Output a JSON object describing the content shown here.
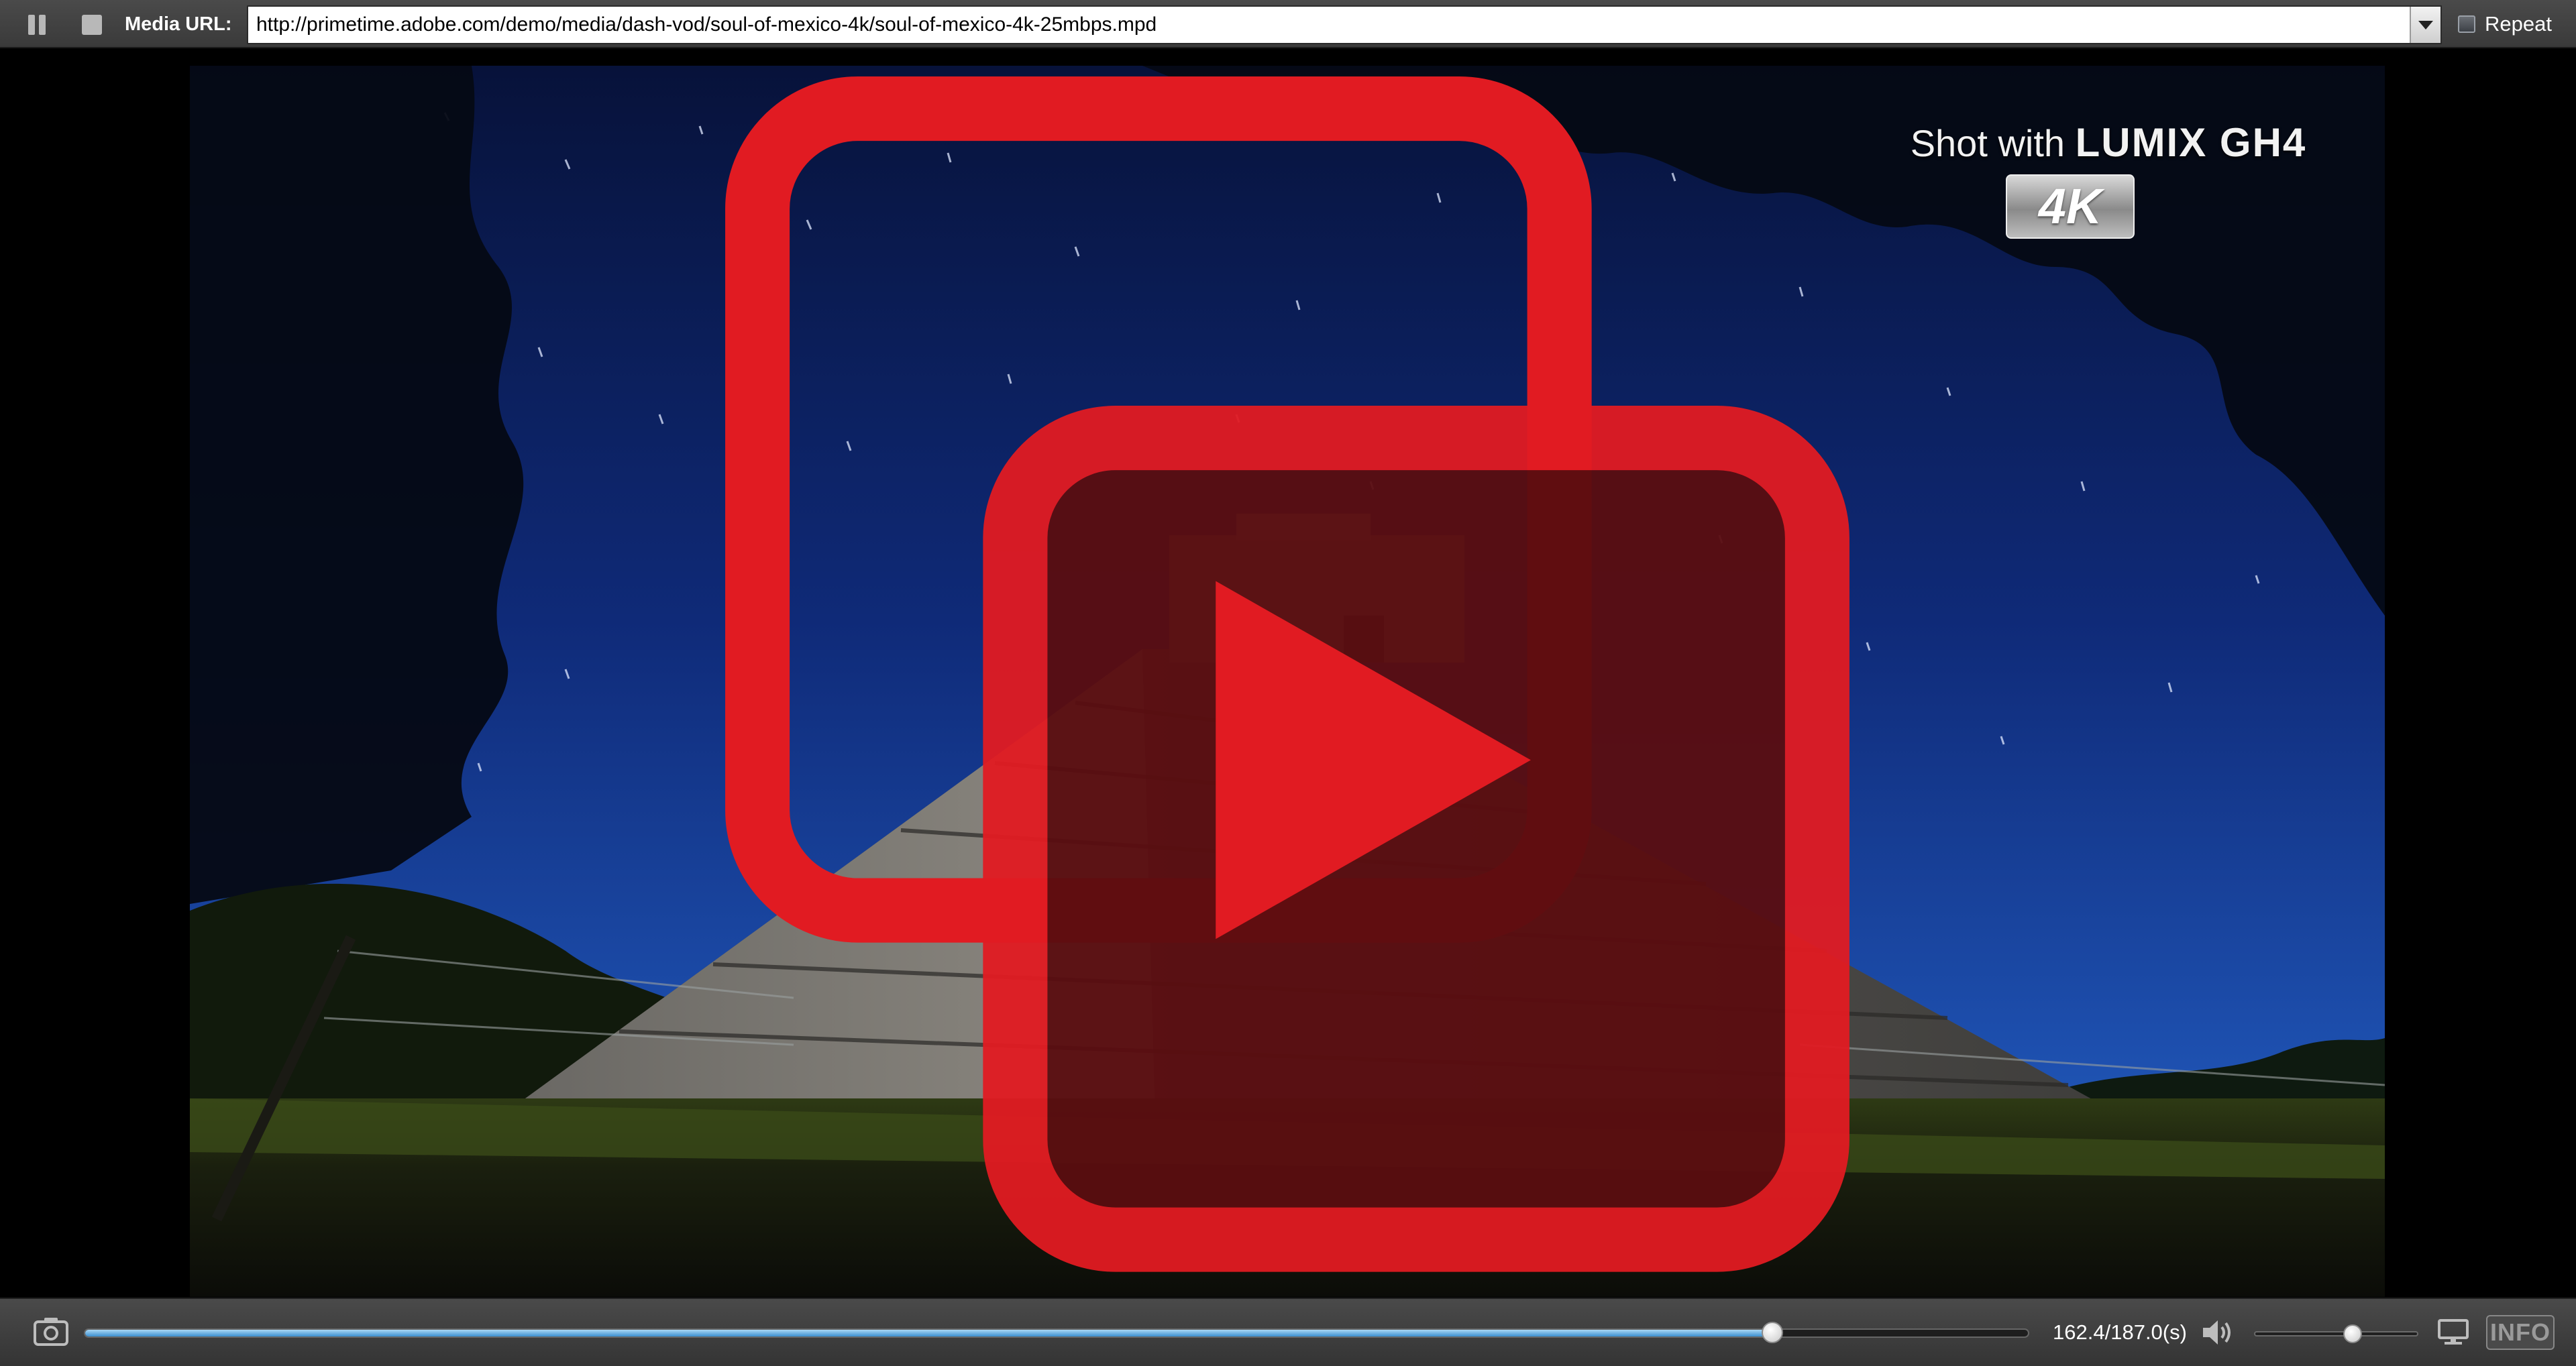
{
  "topbar": {
    "pause_icon": "pause-icon",
    "stop_icon": "stop-icon",
    "url_label": "Media URL:",
    "url_value": "http://primetime.adobe.com/demo/media/dash-vod/soul-of-mexico-4k/soul-of-mexico-4k-25mbps.mpd",
    "repeat_label": "Repeat",
    "repeat_checked": false
  },
  "video": {
    "watermark_prefix": "Shot with",
    "watermark_brand": "LUMIX GH4",
    "badge_4k": "4K",
    "logo_icon": "play-logo-icon"
  },
  "controls": {
    "snapshot_icon": "camera-icon",
    "current_time": 162.4,
    "duration": 187.0,
    "time_text": "162.4/187.0(s)",
    "volume_icon": "speaker-icon",
    "volume_level": 0.6,
    "screen_icon": "monitor-icon",
    "info_label": "INFO"
  },
  "colors": {
    "bar_bg": "#3f3f3f",
    "progress_fill": "#6cb8ec",
    "logo_red": "#e11b22",
    "sky": "#0d1f58"
  }
}
